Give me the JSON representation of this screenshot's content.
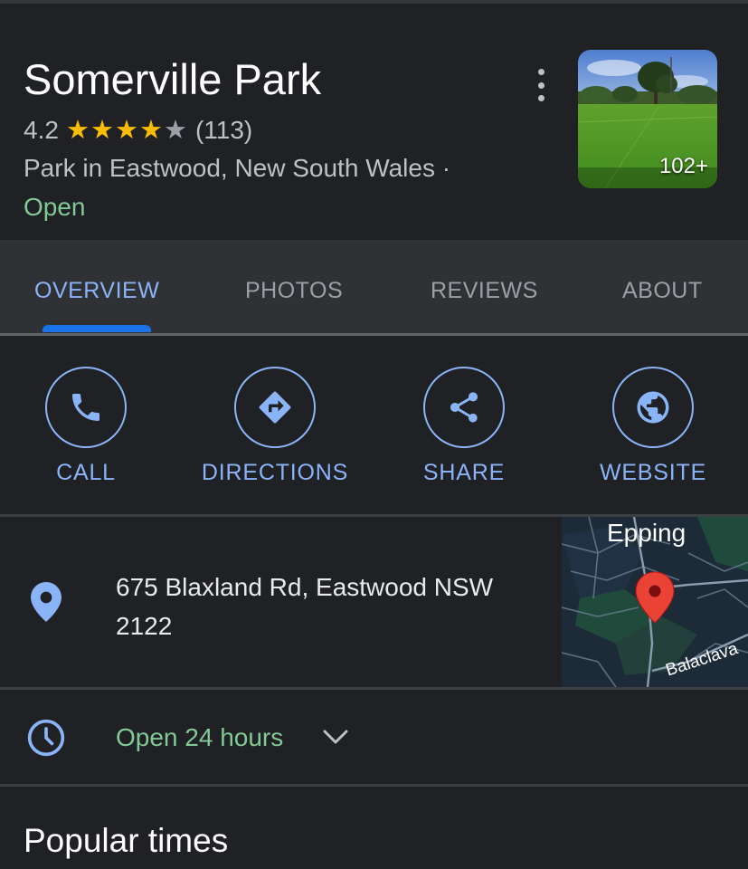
{
  "place": {
    "name": "Somerville Park",
    "rating": "4.2",
    "rating_value": 4.2,
    "stars_filled": 4,
    "stars_total": 5,
    "review_count": "(113)",
    "category_location": "Park in Eastwood, New South Wales ·",
    "status": "Open"
  },
  "photo": {
    "count_badge": "102+"
  },
  "tabs": [
    {
      "label": "OVERVIEW",
      "active": true
    },
    {
      "label": "PHOTOS",
      "active": false
    },
    {
      "label": "REVIEWS",
      "active": false
    },
    {
      "label": "ABOUT",
      "active": false
    }
  ],
  "actions": [
    {
      "label": "CALL",
      "icon": "phone-icon"
    },
    {
      "label": "DIRECTIONS",
      "icon": "directions-icon"
    },
    {
      "label": "SHARE",
      "icon": "share-icon"
    },
    {
      "label": "WEBSITE",
      "icon": "globe-icon"
    }
  ],
  "address": {
    "icon": "location-pin-icon",
    "line1": "675 Blaxland Rd, Eastwood NSW",
    "line2": "2122"
  },
  "map": {
    "label_top": "Epping",
    "label_street": "Balaclava"
  },
  "hours": {
    "icon": "clock-icon",
    "text": "Open 24 hours"
  },
  "sections": {
    "popular_times": "Popular times"
  },
  "colors": {
    "background": "#202124",
    "tab_bar": "#303134",
    "accent_blue": "#8ab4f8",
    "open_green": "#81c995",
    "star_yellow": "#fbbc04",
    "pin_red": "#ea4335"
  }
}
